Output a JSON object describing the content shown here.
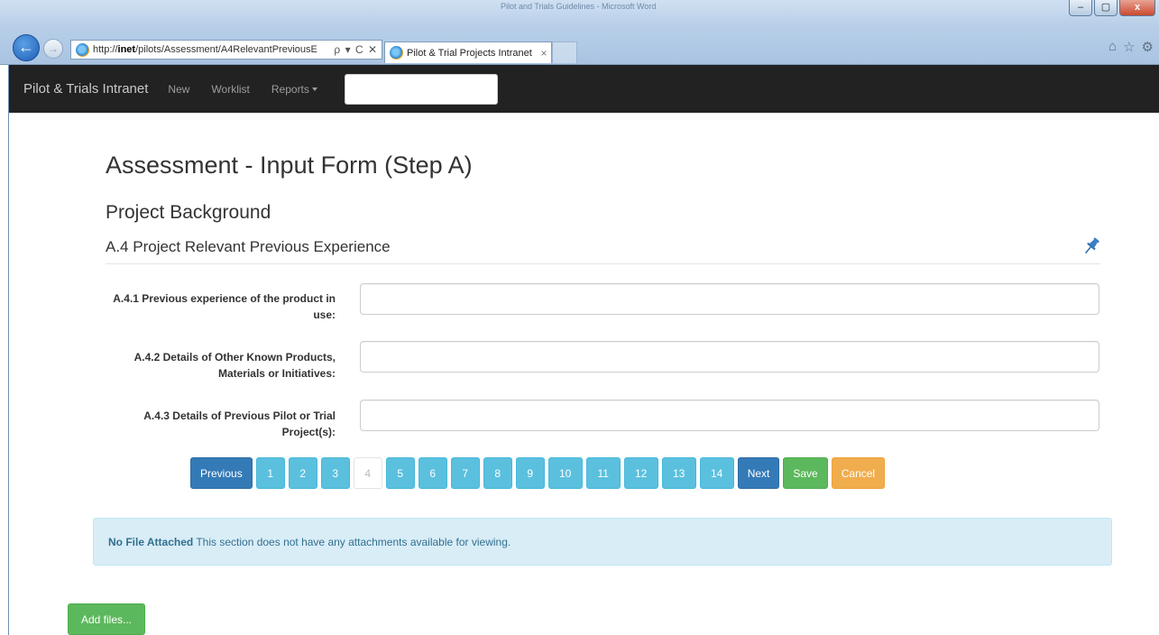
{
  "browser": {
    "window_title": "Pilot and Trials Guidelines - Microsoft Word",
    "address_prefix": "http://",
    "address_host": "inet",
    "address_path": "/pilots/Assessment/A4RelevantPreviousE",
    "address_tools": "ρ ▾ C ✕",
    "tab_title": "Pilot & Trial Projects Intranet",
    "tab_close": "×",
    "back_glyph": "←",
    "forward_glyph": "→",
    "window_controls": [
      "–",
      "▢",
      "x"
    ],
    "right_icons": [
      "⌂",
      "☆",
      "⚙"
    ]
  },
  "navbar": {
    "brand": "Pilot & Trials Intranet",
    "links": [
      "New",
      "Worklist",
      "Reports"
    ],
    "search_value": ""
  },
  "page": {
    "title": "Assessment - Input Form (Step A)",
    "section": "Project Background",
    "subsection": "A.4 Project Relevant Previous Experience"
  },
  "form": {
    "fields": [
      {
        "label": "A.4.1 Previous experience of the product in use:",
        "value": ""
      },
      {
        "label": "A.4.2 Details of Other Known Products, Materials or Initiatives:",
        "value": ""
      },
      {
        "label": "A.4.3 Details of Previous Pilot or Trial Project(s):",
        "value": ""
      }
    ]
  },
  "pagination": {
    "previous": "Previous",
    "pages": [
      "1",
      "2",
      "3",
      "4",
      "5",
      "6",
      "7",
      "8",
      "9",
      "10",
      "11",
      "12",
      "13",
      "14"
    ],
    "current": "4",
    "next": "Next",
    "save": "Save",
    "cancel": "Cancel"
  },
  "attachments": {
    "status_bold": "No File Attached",
    "status_text": " This section does not have any attachments available for viewing."
  },
  "add_files_label": "Add files...",
  "colors": {
    "navbar_bg": "#222222",
    "primary": "#337ab7",
    "info": "#5bc0de",
    "success": "#5cb85c",
    "warning": "#f0ad4e",
    "alert_bg": "#d9edf7"
  }
}
